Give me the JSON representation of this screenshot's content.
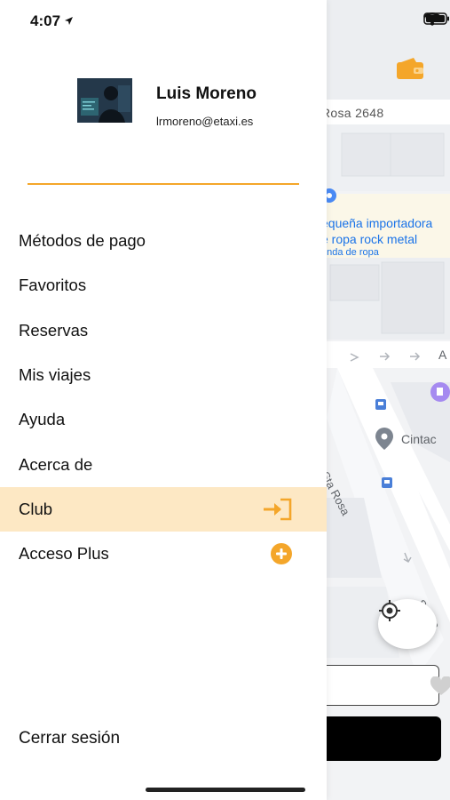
{
  "status_bar": {
    "time": "4:07"
  },
  "user": {
    "name": "Luis Moreno",
    "email": "lrmoreno@etaxi.es"
  },
  "menu": {
    "items": [
      {
        "label": "Métodos de pago",
        "name": "menu-item-metodos-de-pago"
      },
      {
        "label": "Favoritos",
        "name": "menu-item-favoritos"
      },
      {
        "label": "Reservas",
        "name": "menu-item-reservas"
      },
      {
        "label": "Mis viajes",
        "name": "menu-item-mis-viajes"
      },
      {
        "label": "Ayuda",
        "name": "menu-item-ayuda"
      },
      {
        "label": "Acerca de",
        "name": "menu-item-acerca-de"
      },
      {
        "label": "Club",
        "name": "menu-item-club",
        "active": true,
        "icon": "login-arrow-icon"
      },
      {
        "label": "Acceso Plus",
        "name": "menu-item-acceso-plus",
        "icon": "plus-circle-icon"
      }
    ],
    "logout_label": "Cerrar sesión"
  },
  "map": {
    "street_label": "Rosa 2648",
    "poi_line1": "equeña importadora",
    "poi_line2": "e ropa rock metal",
    "poi_line3": "enda de ropa",
    "cintac_label": "Cintac",
    "sta_rosa_label": "Sta Rosa",
    "sta_rosa_label2": "Sta. R",
    "corner_label": "A"
  },
  "colors": {
    "accent": "#f4a62a",
    "active_bg": "#fde8c4",
    "poi_text": "#1a73e8"
  }
}
